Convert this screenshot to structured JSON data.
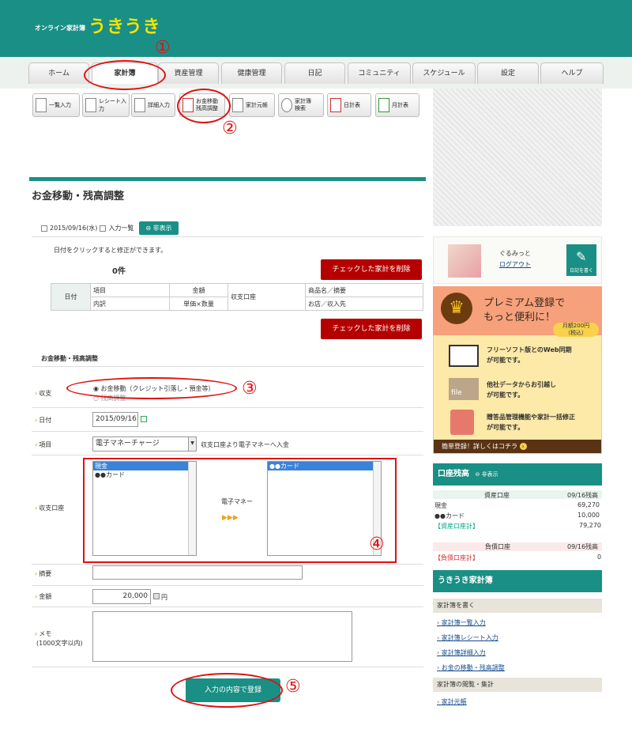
{
  "header": {
    "subtitle": "オンライン家計簿",
    "logo": "うきうき"
  },
  "nav": {
    "tabs": [
      "ホーム",
      "家計簿",
      "資産管理",
      "健康管理",
      "日記",
      "コミュニティ",
      "スケジュール",
      "設定",
      "ヘルプ"
    ]
  },
  "toolbar": {
    "items": [
      "一覧入力",
      "レシート入力",
      "詳細入力",
      "お金移動\n残高調整",
      "家計元帳",
      "家計簿\n検索",
      "日計表",
      "月計表"
    ]
  },
  "annotations": [
    "①",
    "②",
    "③",
    "④",
    "⑤"
  ],
  "page": {
    "title": "お金移動・残高調整"
  },
  "list": {
    "date": "2015/09/16(水)",
    "list_label": "入力一覧",
    "hide_button": "非表示",
    "hint": "日付をクリックすると修正ができます。",
    "count": "0件",
    "delete_button": "チェックした家計を削除",
    "delete_button2": "チェックした家計を削除"
  },
  "table": {
    "date": "日付",
    "item": "項目",
    "detail": "内訳",
    "amount": "金額",
    "unit": "単価×数量",
    "account": "収支口座",
    "product": "商品名／摘要",
    "shop": "お店／収入先"
  },
  "form": {
    "section_title": "お金移動・残高調整",
    "type_label": "収支",
    "type_opt1": "お金移動（クレジット引落し・預金等）",
    "type_opt2": "残高調整",
    "date_label": "日付",
    "date_value": "2015/09/16",
    "item_label": "項目",
    "item_value": "電子マネーチャージ",
    "item_note": "収支口座より電子マネーへ入金",
    "account_label": "収支口座",
    "from_accounts": [
      "現金",
      "●●カード"
    ],
    "transfer_label": "電子マネー",
    "arrow": "▶▶▶",
    "to_accounts": [
      "●●カード"
    ],
    "memo_title_label": "摘要",
    "amount_label": "金額",
    "amount_value": "20,000",
    "yen": "円",
    "memo_label": "メモ",
    "memo_sub": "(1000文字以内)",
    "submit": "入力の内容で登録"
  },
  "user": {
    "name": "ぐるみっと",
    "logout": "ログアウト",
    "diary": "日記を書く"
  },
  "premium": {
    "title1": "プレミアム登録で",
    "title2": "もっと便利に！",
    "price": "月額200円",
    "tax": "（税込）",
    "f1a": "フリーソフト版とのWeb同期",
    "f1b": "が可能です。",
    "f2a": "他社データからお引越し",
    "f2b": "が可能です。",
    "f3a": "贈答品管理機能や家計一括修正",
    "f3b": "が可能です。",
    "file_word": "file",
    "cta": "簡単登録！詳しくはコチラ"
  },
  "balance": {
    "title": "口座残高",
    "hide": "非表示",
    "asset_head": "資産口座",
    "date1": "09/16残高",
    "rows": [
      {
        "name": "現金",
        "value": "69,270"
      },
      {
        "name": "●●カード",
        "value": "10,000"
      }
    ],
    "asset_total_label": "【資産口座計】",
    "asset_total": "79,270",
    "debt_head": "負債口座",
    "date2": "09/16残高",
    "debt_total_label": "【負債口座計】",
    "debt_total": "0"
  },
  "sidebar": {
    "title": "うきうき家計簿",
    "cat1": "家計簿を書く",
    "links1": [
      "家計簿一覧入力",
      "家計簿レシート入力",
      "家計簿詳細入力",
      "お金の移動・残高調整"
    ],
    "cat2": "家計簿の閲覧・集計",
    "links2": [
      "家計元帳"
    ]
  },
  "colors": {
    "teal": "#1a8f85",
    "red_button": "#b50000",
    "annotation": "#e01010"
  }
}
